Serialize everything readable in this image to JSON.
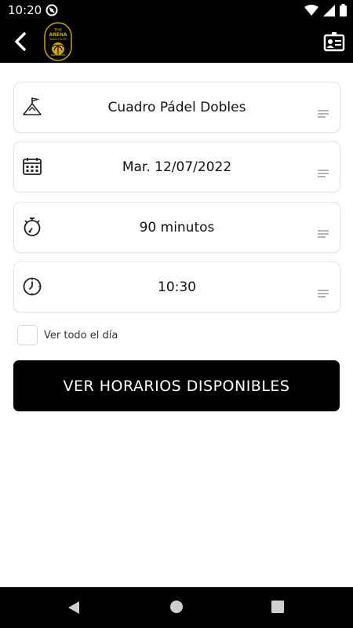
{
  "status": {
    "time": "10:20"
  },
  "header": {
    "logo_text": [
      "THE",
      "ARENA",
      "BEACH CLUB"
    ]
  },
  "fields": [
    {
      "value": "Cuadro Pádel Dobles",
      "icon": "court-flag-icon"
    },
    {
      "value": "Mar. 12/07/2022",
      "icon": "calendar-icon"
    },
    {
      "value": "90 minutos",
      "icon": "stopwatch-icon"
    },
    {
      "value": "10:30",
      "icon": "clock-icon"
    }
  ],
  "all_day": {
    "label": "Ver todo el día",
    "checked": false
  },
  "action": {
    "label": "VER HORARIOS DISPONIBLES"
  },
  "colors": {
    "primary": "#000000",
    "logo_gold": "#c9a227"
  }
}
